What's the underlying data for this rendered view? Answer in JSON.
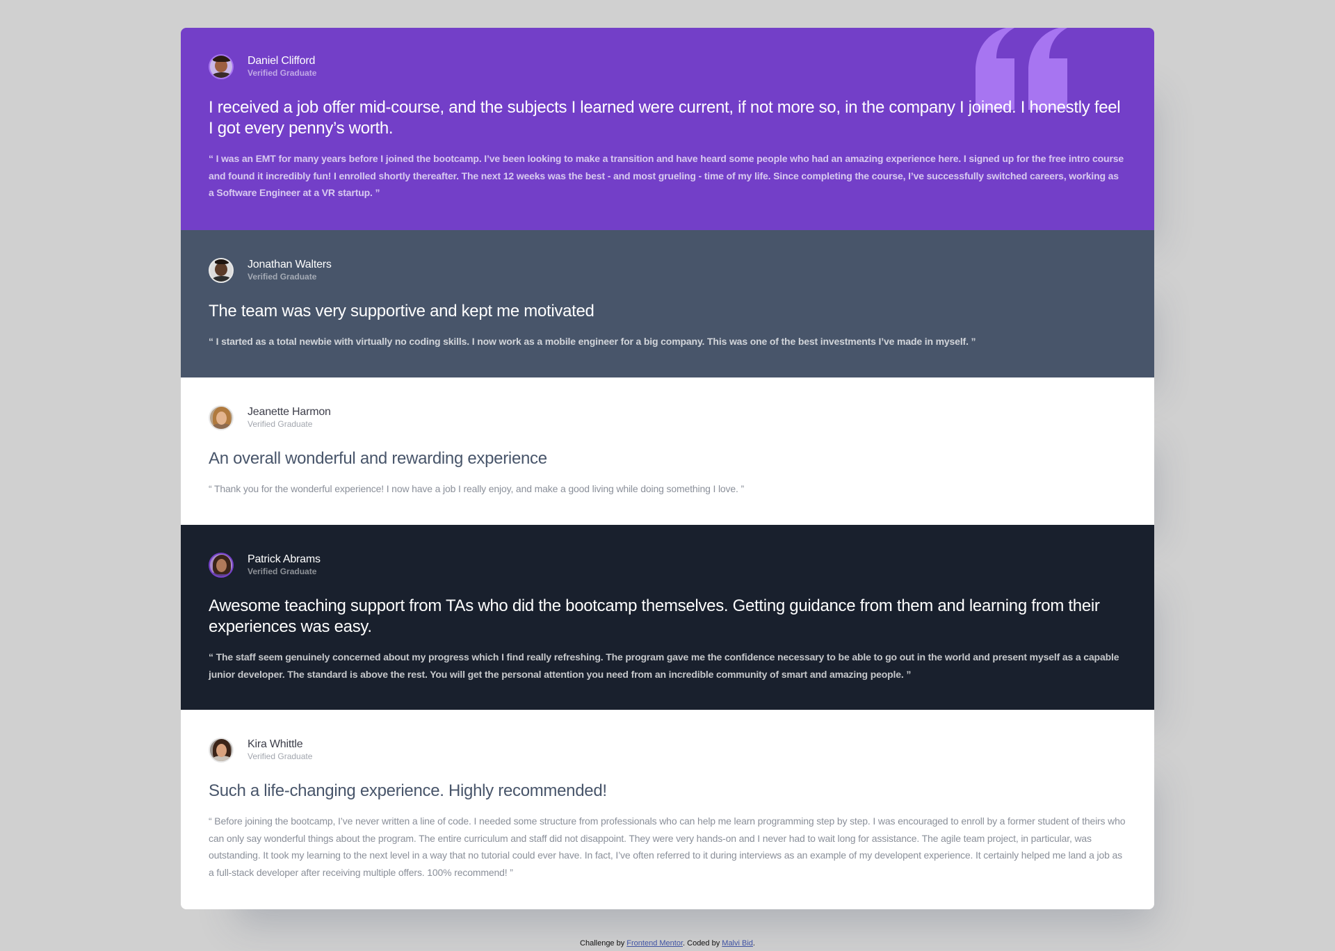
{
  "testimonials": [
    {
      "name": "Daniel Clifford",
      "role": "Verified Graduate",
      "headline": "I received a job offer mid-course, and the subjects I learned were current, if not more so, in the company I joined. I honestly feel I got every penny’s worth.",
      "body": "“ I was an EMT for many years before I joined the bootcamp. I’ve been looking to make a transition and have heard some people who had an amazing experience here. I signed up for the free intro course and found it incredibly fun! I enrolled shortly thereafter. The next 12 weeks was the best - and most grueling - time of my life. Since completing the course, I’ve successfully switched careers, working as a Software Engineer at a VR startup. ”",
      "card_color": "#733fc8",
      "avatar_ring": "#a775f1",
      "avatar_skin": "#9c5f3f",
      "avatar_hair": "#2a1a12",
      "avatar_shirt": "#3a2a2a"
    },
    {
      "name": "Jonathan Walters",
      "role": "Verified Graduate",
      "headline": "The team was very supportive and kept me motivated",
      "body": "“ I started as a total newbie with virtually no coding skills. I now work as a mobile engineer for a big company. This was one of the best investments I’ve made in myself. ”",
      "card_color": "#48556a",
      "avatar_ring": "#e8e8e8",
      "avatar_skin": "#5a3a28",
      "avatar_hair": "#1d1410",
      "avatar_shirt": "#2d2d2d"
    },
    {
      "name": "Jeanette Harmon",
      "role": "Verified Graduate",
      "headline": "An overall wonderful and rewarding experience",
      "body": "“ Thank you for the wonderful experience! I now have a job I really enjoy, and make a good living while doing something I love. ”",
      "card_color": "#ffffff",
      "avatar_ring": "#e8e8e8",
      "avatar_skin": "#e3b48e",
      "avatar_hair": "#b07a3e",
      "avatar_shirt": "#8d6b50"
    },
    {
      "name": "Patrick Abrams",
      "role": "Verified Graduate",
      "headline": "Awesome teaching support from TAs who did the bootcamp themselves. Getting guidance from them and learning from their experiences was easy.",
      "body": "“ The staff seem genuinely concerned about my progress which I find really refreshing. The program gave me the confidence necessary to be able to go out in the world and present myself as a capable junior developer. The standard is above the rest. You will get the personal attention you need from an incredible community of smart and amazing people. ”",
      "card_color": "#19202d",
      "avatar_ring": "#733fc8",
      "avatar_skin": "#b07a5a",
      "avatar_hair": "#3a2418",
      "avatar_shirt": "#5b3f86"
    },
    {
      "name": "Kira Whittle",
      "role": "Verified Graduate",
      "headline": "Such a life-changing experience. Highly recommended!",
      "body": "“ Before joining the bootcamp, I’ve never written a line of code. I needed some structure from professionals who can help me learn programming step by step. I was encouraged to enroll by a former student of theirs who can only say wonderful things about the program. The entire curriculum and staff did not disappoint. They were very hands-on and I never had to wait long for assistance. The agile team project, in particular, was outstanding. It took my learning to the next level in a way that no tutorial could ever have. In fact, I’ve often referred to it during interviews as an example of my developent experience. It certainly helped me land a job as a full-stack developer after receiving multiple offers. 100% recommend! ”",
      "card_color": "#ffffff",
      "avatar_ring": "#e8e8e8",
      "avatar_skin": "#d9a27e",
      "avatar_hair": "#3b2418",
      "avatar_shirt": "#c9c1b8"
    }
  ],
  "quote_icon": "quote-mark-icon",
  "quote_icon_color": "#a775f1",
  "attribution": {
    "prefix": "Challenge by ",
    "link1": "Frontend Mentor",
    "middle": ". Coded by ",
    "link2": "Malvi Bid",
    "suffix": "."
  }
}
